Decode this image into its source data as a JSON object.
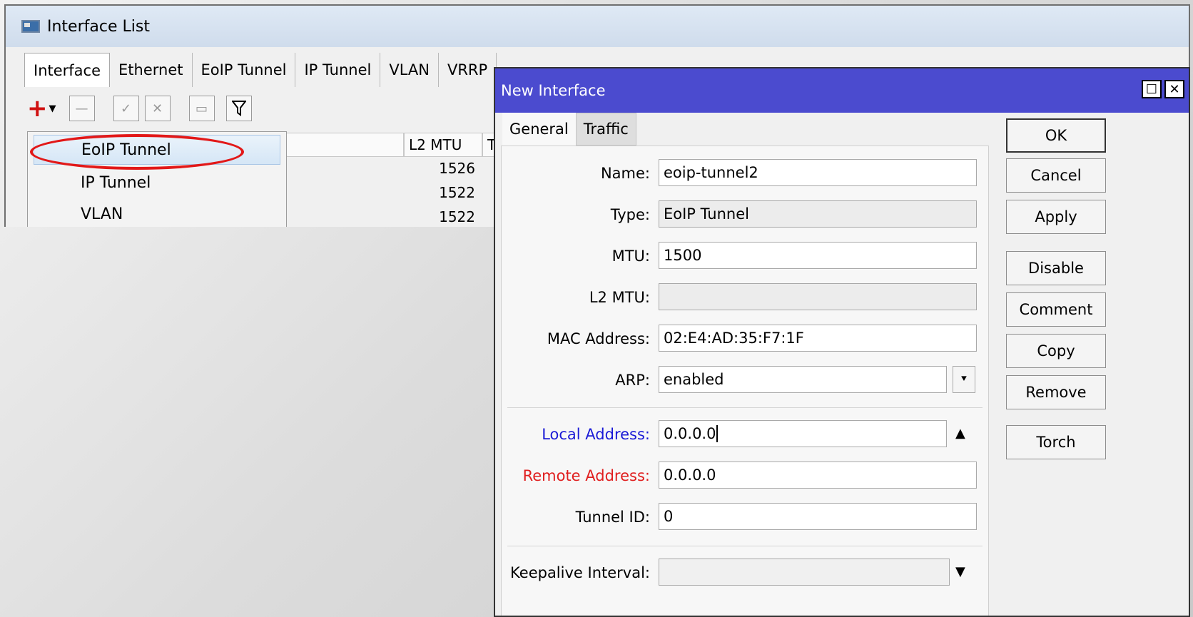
{
  "interface_list": {
    "title": "Interface List",
    "tabs": [
      "Interface",
      "Ethernet",
      "EoIP Tunnel",
      "IP Tunnel",
      "VLAN",
      "VRRP"
    ],
    "columns": {
      "l2mtu": "L2 MTU",
      "tx": "Tx"
    },
    "rows": [
      {
        "l2mtu": "1526"
      },
      {
        "l2mtu": "1522"
      },
      {
        "l2mtu": "1522"
      }
    ],
    "add_menu": [
      "EoIP Tunnel",
      "IP Tunnel",
      "VLAN"
    ]
  },
  "dialog": {
    "title": "New Interface",
    "tabs": [
      "General",
      "Traffic"
    ],
    "fields": {
      "name": {
        "label": "Name:",
        "value": "eoip-tunnel2"
      },
      "type": {
        "label": "Type:",
        "value": "EoIP Tunnel"
      },
      "mtu": {
        "label": "MTU:",
        "value": "1500"
      },
      "l2mtu": {
        "label": "L2 MTU:",
        "value": ""
      },
      "mac": {
        "label": "MAC Address:",
        "value": "02:E4:AD:35:F7:1F"
      },
      "arp": {
        "label": "ARP:",
        "value": "enabled"
      },
      "local_address": {
        "label": "Local Address:",
        "value": "0.0.0.0"
      },
      "remote_address": {
        "label": "Remote Address:",
        "value": "0.0.0.0"
      },
      "tunnel_id": {
        "label": "Tunnel ID:",
        "value": "0"
      },
      "keepalive": {
        "label": "Keepalive Interval:",
        "value": ""
      }
    },
    "buttons": {
      "ok": "OK",
      "cancel": "Cancel",
      "apply": "Apply",
      "disable": "Disable",
      "comment": "Comment",
      "copy": "Copy",
      "remove": "Remove",
      "torch": "Torch"
    }
  },
  "colors": {
    "dialog_titlebar": "#4b4bcf",
    "local_label": "#1a1ad6",
    "remote_label": "#e01e1e",
    "highlight": "#e21818"
  }
}
